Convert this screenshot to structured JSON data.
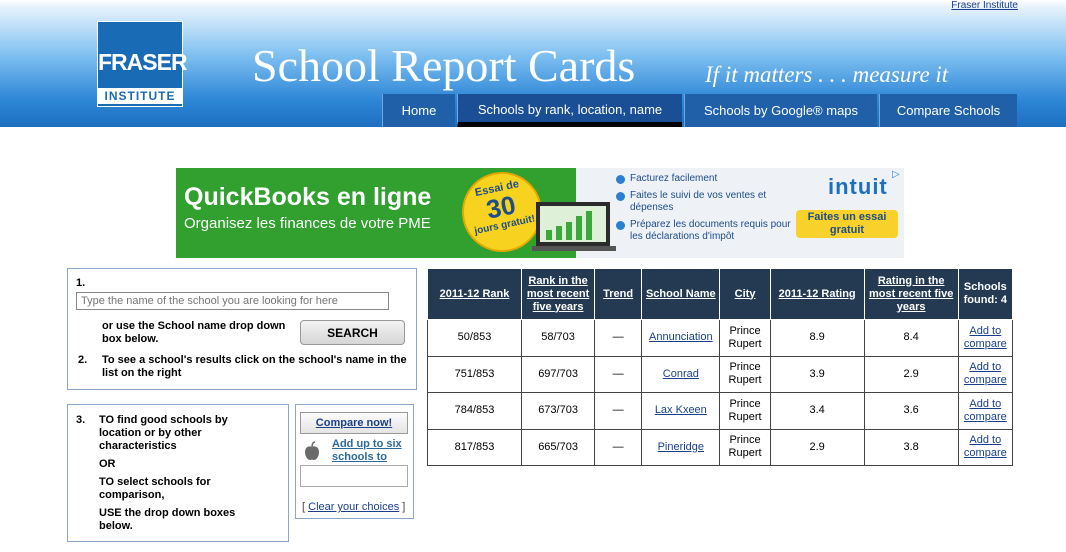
{
  "header": {
    "top_link": "Fraser Institute",
    "logo_line1": "FRASER",
    "logo_line2": "INSTITUTE",
    "title": "School Report Cards",
    "tagline": "If it matters . . . measure it"
  },
  "nav": {
    "items": [
      {
        "label": "Home",
        "active": false
      },
      {
        "label": "Schools by rank, location, name",
        "active": true
      },
      {
        "label": "Schools by Google® maps",
        "active": false
      },
      {
        "label": "Compare Schools",
        "active": false
      }
    ]
  },
  "ad": {
    "title": "QuickBooks en ligne",
    "subtitle": "Organisez les finances de votre PME",
    "badge_line1": "Essai de",
    "badge_line2": "30",
    "badge_line3": "jours gratuit!",
    "bullets": [
      "Facturez facilement",
      "Faites le suivi de vos ventes et dépenses",
      "Préparez les documents requis pour les déclarations d'impôt"
    ],
    "brand": "intuit",
    "cta": "Faites un essai gratuit",
    "colors": {
      "green": "#31a02f",
      "yellow": "#f8d12a",
      "blue": "#1d6fbf"
    }
  },
  "search": {
    "step1_num": "1.",
    "placeholder": "Type the name of the school you are looking for here",
    "or_text": "or use the School name drop down box below.",
    "button_label": "SEARCH",
    "step2_num": "2.",
    "step2_text": "To see a school's results click on the school's name in the list on the right"
  },
  "filter": {
    "step3_num": "3.",
    "line1": "TO find good schools by location or by other characteristics",
    "or": "OR",
    "line2": "TO select schools for comparison,",
    "line3": "USE the drop down boxes below."
  },
  "compare": {
    "button_label": "Compare now!",
    "add_text": "Add up to six schools to compare",
    "clear_open": "[",
    "clear_label": "Clear your choices",
    "clear_close": "]",
    "icon": "apple-icon"
  },
  "table": {
    "headers": [
      "2011-12 Rank",
      "Rank in the most recent five years",
      "Trend",
      "School Name",
      "City",
      "2011-12 Rating",
      "Rating in the most recent five years",
      "Schools found: 4"
    ],
    "rows": [
      {
        "rank": "50/853",
        "rank5": "58/703",
        "trend": "—",
        "school": "Annunciation",
        "city": "Prince Rupert",
        "rating": "8.9",
        "rating5": "8.4",
        "action": "Add to compare"
      },
      {
        "rank": "751/853",
        "rank5": "697/703",
        "trend": "—",
        "school": "Conrad",
        "city": "Prince Rupert",
        "rating": "3.9",
        "rating5": "2.9",
        "action": "Add to compare"
      },
      {
        "rank": "784/853",
        "rank5": "673/703",
        "trend": "—",
        "school": "Lax Kxeen",
        "city": "Prince Rupert",
        "rating": "3.4",
        "rating5": "3.6",
        "action": "Add to compare"
      },
      {
        "rank": "817/853",
        "rank5": "665/703",
        "trend": "—",
        "school": "Pineridge",
        "city": "Prince Rupert",
        "rating": "2.9",
        "rating5": "3.8",
        "action": "Add to compare"
      }
    ],
    "colors": {
      "header_bg": "#233a52",
      "link": "#1a3f8b"
    }
  }
}
